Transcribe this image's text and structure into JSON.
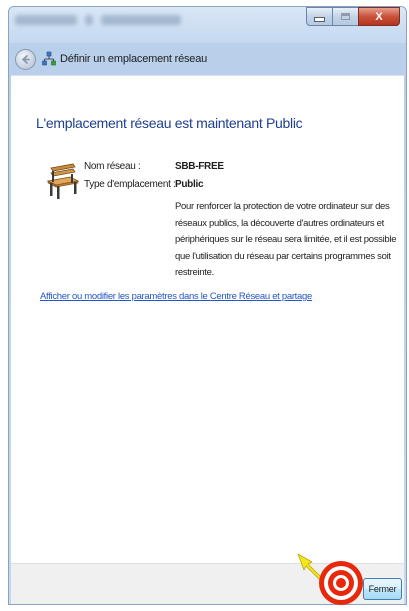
{
  "window": {
    "title": "Définir un emplacement réseau",
    "close_glyph": "X"
  },
  "main": {
    "heading": "L'emplacement réseau est maintenant Public",
    "network_name_label": "Nom réseau :",
    "network_name_value": "SBB-FREE",
    "location_type_label": "Type d'emplacement :",
    "location_type_value": "Public",
    "description": "Pour renforcer la protection de votre ordinateur sur des réseaux publics, la découverte d'autres ordinateurs et périphériques sur le réseau sera limitée, et il est possible que l'utilisation du réseau par certains programmes soit restreinte.",
    "link_text": "Afficher ou modifier les paramètres dans le Centre Réseau et partage"
  },
  "footer": {
    "close_label": "Fermer"
  },
  "icons": {
    "back": "back-arrow-icon",
    "network": "network-icon",
    "location": "park-bench-icon",
    "annotation": "target-icon"
  },
  "colors": {
    "heading": "#1f3f8f",
    "link": "#2456c8",
    "annotation_red": "#e8280c",
    "annotation_yellow": "#f5e51c"
  }
}
